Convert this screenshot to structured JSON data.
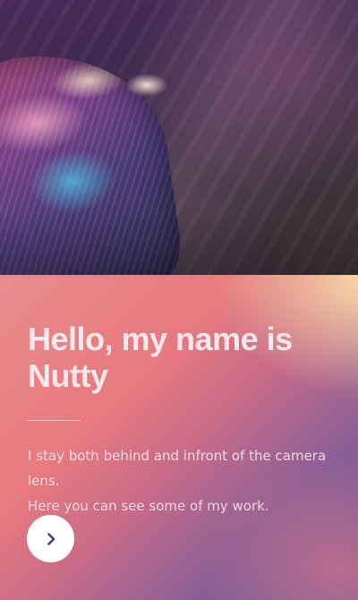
{
  "hero": {
    "image": "abstract-iridescent-shell-photo"
  },
  "intro": {
    "title_line1": "Hello, my name is",
    "title_line2": "Nutty",
    "description_line1": "I stay both behind and infront of the camera lens.",
    "description_line2": "Here you can see some of my work."
  },
  "next_button": {
    "icon": "chevron-right-icon",
    "icon_color": "#4b3f6b"
  },
  "colors": {
    "title_text": "#f9e7ec",
    "gradient_warm": "#e77a7f",
    "gradient_cool": "#6c5c9b",
    "gradient_highlight": "#ffe8aa"
  }
}
